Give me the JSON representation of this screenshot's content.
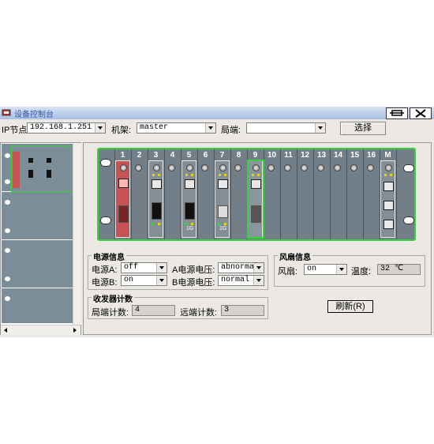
{
  "window": {
    "title": "设备控制台",
    "title_buttons": [
      "restore",
      "close"
    ]
  },
  "toolbar": {
    "ip_label": "IP节点",
    "ip_value": "192.168.1.251",
    "rack_label": "机架:",
    "rack_value": "master",
    "remote_label": "局端:",
    "remote_value": "",
    "select_button": "选择"
  },
  "chassis": {
    "slots": [
      "1",
      "2",
      "3",
      "4",
      "5",
      "6",
      "7",
      "8",
      "9",
      "10",
      "11",
      "12",
      "13",
      "14",
      "15",
      "16",
      "M"
    ],
    "card_labels": {
      "slot5": "1G",
      "slot7": "1G"
    }
  },
  "power_info": {
    "title": "电源信息",
    "power_a_label": "电源A:",
    "power_a_value": "off",
    "power_a_voltage_label": "A电源电压:",
    "power_a_voltage_value": "abnormal",
    "power_b_label": "电源B:",
    "power_b_value": "on",
    "power_b_voltage_label": "B电源电压:",
    "power_b_voltage_value": "normal"
  },
  "fan_info": {
    "title": "风扇信息",
    "fan_label": "风扇:",
    "fan_value": "on",
    "temp_label": "温度:",
    "temp_value": "32 ℃"
  },
  "counter": {
    "title": "收发器计数",
    "local_label": "局端计数:",
    "local_value": "4",
    "remote_label": "远端计数:",
    "remote_value": "3"
  },
  "refresh_button": "刷新(R)",
  "colors": {
    "selection_green": "#3ad23a",
    "card_red": "#c55353",
    "chassis_gray": "#737f88",
    "led_yellow": "#e8d400"
  }
}
